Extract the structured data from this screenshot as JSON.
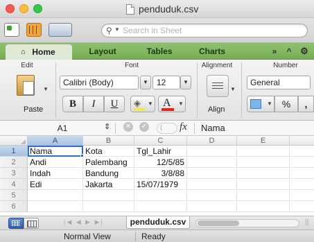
{
  "window": {
    "title": "penduduk.csv"
  },
  "toolbar": {
    "search_placeholder": "Search in Sheet"
  },
  "ribbon_tabs": {
    "home": "Home",
    "layout": "Layout",
    "tables": "Tables",
    "charts": "Charts",
    "more": "»",
    "collapse": "^",
    "gear": "⚙"
  },
  "ribbon": {
    "groups": {
      "edit": "Edit",
      "font": "Font",
      "alignment": "Alignment",
      "number": "Number"
    },
    "paste_label": "Paste",
    "font_name": "Calibri (Body)",
    "font_size": "12",
    "bold": "B",
    "italic": "I",
    "underline": "U",
    "font_color_letter": "A",
    "align_label": "Align",
    "number_format": "General",
    "percent": "%",
    "comma": ","
  },
  "formula_bar": {
    "cell_ref": "A1",
    "fx": "fx",
    "content": "Nama"
  },
  "grid": {
    "columns": [
      "A",
      "B",
      "C",
      "D",
      "E"
    ],
    "rows": [
      "1",
      "2",
      "3",
      "4",
      "5",
      "6"
    ],
    "cells": [
      [
        "Nama",
        "Kota",
        "Tgl_Lahir",
        "",
        ""
      ],
      [
        "Andi",
        "Palembang",
        "12/5/85",
        "",
        ""
      ],
      [
        "Indah",
        "Bandung",
        "3/8/88",
        "",
        ""
      ],
      [
        "Edi",
        "Jakarta",
        "15/07/1979",
        "",
        ""
      ],
      [
        "",
        "",
        "",
        "",
        ""
      ],
      [
        "",
        "",
        "",
        "",
        ""
      ]
    ],
    "selected_cell": "A1"
  },
  "sheet_tabs": {
    "active": "penduduk.csv"
  },
  "status": {
    "view": "Normal View",
    "state": "Ready"
  },
  "colors": {
    "ribbon_green": "#8fc16f",
    "selection_blue": "#2f6fc7",
    "close": "#f25a52",
    "minimize": "#f6bd3b",
    "maximize": "#3cc34a"
  }
}
